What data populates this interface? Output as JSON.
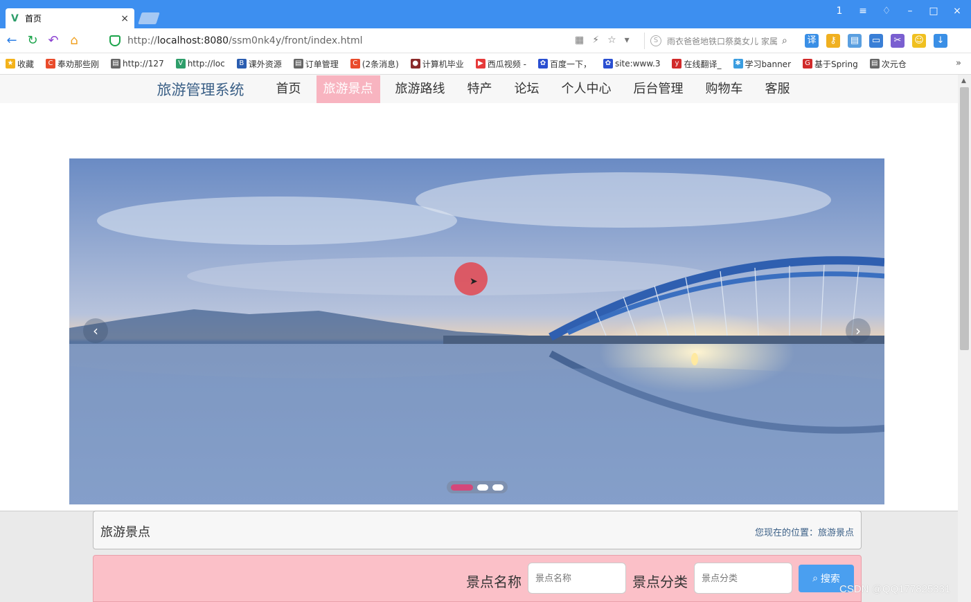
{
  "browser": {
    "tab_title": "首页",
    "tab_close": "×",
    "window_controls": [
      "1",
      "≡",
      "♢",
      "–",
      "□",
      "×"
    ],
    "url_host": "localhost:8080",
    "url_prefix": "http://",
    "url_path": "/ssm0nk4y/front/index.html",
    "search_text": "雨衣爸爸地铁口祭奠女儿 家属",
    "bookmarks": [
      {
        "label": "收藏",
        "color": "#f3b21b",
        "icon": "star-icon"
      },
      {
        "label": "奉劝那些刚",
        "color": "#e94b2b",
        "icon": "csdn-icon"
      },
      {
        "label": "http://127",
        "color": "#666666",
        "icon": "page-icon"
      },
      {
        "label": "http://loc",
        "color": "#2e9e6a",
        "icon": "vue-icon"
      },
      {
        "label": "课外资源",
        "color": "#2a5db0",
        "icon": "book-icon"
      },
      {
        "label": "订单管理",
        "color": "#666666",
        "icon": "page-icon"
      },
      {
        "label": "(2条消息)",
        "color": "#e94b2b",
        "icon": "csdn-icon"
      },
      {
        "label": "计算机毕业",
        "color": "#8a2a2a",
        "icon": "avatar-icon"
      },
      {
        "label": "西瓜视频 -",
        "color": "#e63a3a",
        "icon": "play-icon"
      },
      {
        "label": "百度一下，",
        "color": "#2a4fd1",
        "icon": "baidu-icon"
      },
      {
        "label": "site:www.3",
        "color": "#2a4fd1",
        "icon": "baidu-icon"
      },
      {
        "label": "在线翻译_",
        "color": "#d12a2a",
        "icon": "youdao-icon"
      },
      {
        "label": "学习banner",
        "color": "#3a9de0",
        "icon": "globe-icon"
      },
      {
        "label": "基于Spring",
        "color": "#d12a2a",
        "icon": "g-icon"
      },
      {
        "label": "次元仓",
        "color": "#666666",
        "icon": "page-icon"
      }
    ],
    "bookmarks_more": "»"
  },
  "site": {
    "brand": "旅游管理系统",
    "nav": [
      "首页",
      "旅游景点",
      "旅游路线",
      "特产",
      "论坛",
      "个人中心",
      "后台管理",
      "购物车",
      "客服"
    ],
    "active_nav": "旅游景点"
  },
  "carousel": {
    "prev": "‹",
    "next": "›",
    "slide_count": 3,
    "active_index": 0
  },
  "breadcrumb": {
    "title": "旅游景点",
    "location": "您现在的位置：旅游景点"
  },
  "search_form": {
    "name_label": "景点名称",
    "name_placeholder": "景点名称",
    "category_label": "景点分类",
    "category_placeholder": "景点分类",
    "button_label": "搜索"
  },
  "watermark": "CSDN @QQ177825331"
}
